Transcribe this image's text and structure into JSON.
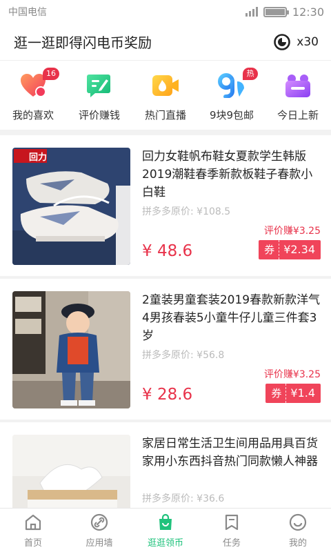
{
  "status_bar": {
    "carrier": "中国电信",
    "time": "12:30"
  },
  "header": {
    "title": "逛一逛即得闪电币奖励",
    "coin_count": "x30"
  },
  "quick_menu": [
    {
      "label": "我的喜欢",
      "icon": "heart-icon",
      "badge": "16"
    },
    {
      "label": "评价赚钱",
      "icon": "review-edit-icon",
      "badge": ""
    },
    {
      "label": "热门直播",
      "icon": "live-video-icon",
      "badge": ""
    },
    {
      "label": "9块9包邮",
      "icon": "nine-nine-icon",
      "badge": "热"
    },
    {
      "label": "今日上新",
      "icon": "new-arrival-icon",
      "badge": ""
    }
  ],
  "products": [
    {
      "title": "回力女鞋帆布鞋女夏款学生韩版2019潮鞋春季新款板鞋子春款小白鞋",
      "original_price": "拼多多原价: ¥108.5",
      "price": "¥ 48.6",
      "reward": "评价赚¥3.25",
      "coupon_label": "券",
      "coupon_amount": "¥2.34",
      "image_brand_text": "回力"
    },
    {
      "title": "2童装男童套装2019春款新款洋气4男孩春装5小童牛仔儿童三件套3岁",
      "original_price": "拼多多原价: ¥56.8",
      "price": "¥ 28.6",
      "reward": "评价赚¥3.25",
      "coupon_label": "券",
      "coupon_amount": "¥1.4"
    },
    {
      "title": "家居日常生活卫生间用品用具百货家用小东西抖音热门同款懒人神器",
      "original_price": "拼多多原价: ¥36.6",
      "price": "",
      "reward": "",
      "coupon_label": "",
      "coupon_amount": ""
    }
  ],
  "tabbar": [
    {
      "label": "首页",
      "icon": "home-icon",
      "active": false
    },
    {
      "label": "应用墙",
      "icon": "link-icon",
      "active": false
    },
    {
      "label": "逛逛领币",
      "icon": "shopping-bag-icon",
      "active": true
    },
    {
      "label": "任务",
      "icon": "bookmark-icon",
      "active": false
    },
    {
      "label": "我的",
      "icon": "smiley-icon",
      "active": false
    }
  ],
  "colors": {
    "accent_red": "#e8324a",
    "accent_green": "#1fc27c"
  }
}
